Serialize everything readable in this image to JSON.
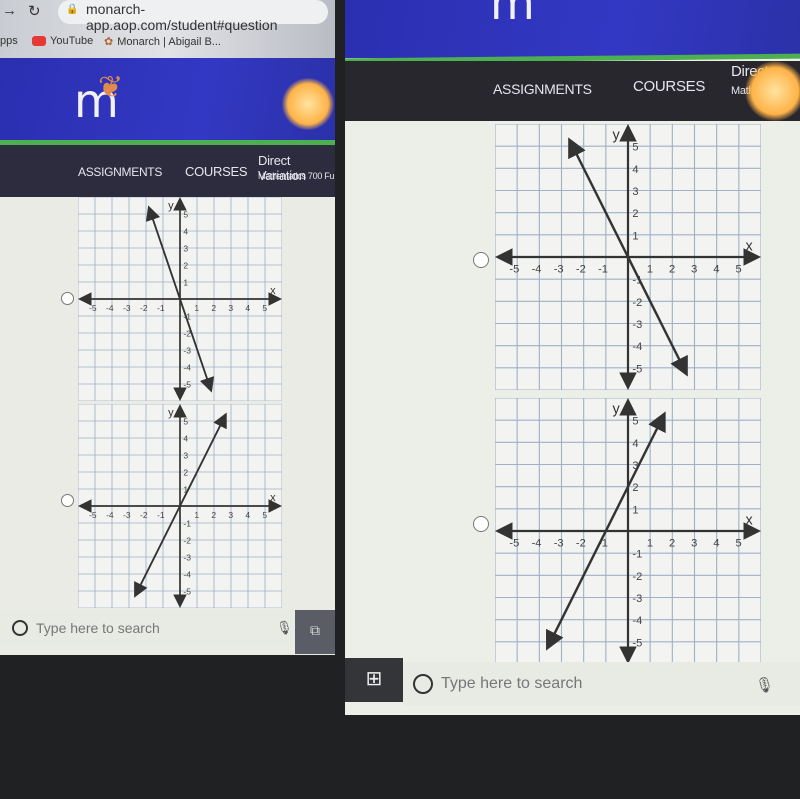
{
  "browser": {
    "url": "monarch-app.aop.com/student#question",
    "bookmarks": [
      "pps",
      "YouTube",
      "Monarch | Abigail B..."
    ]
  },
  "nav": {
    "assignments": "ASSIGNMENTS",
    "courses": "COURSES",
    "lesson_title": "Direct Variation",
    "lesson_subtitle": "Mathematics 700 Fu",
    "lesson_title_partial": "Direct",
    "lesson_subtitle_partial": "Mathe"
  },
  "logo": "m",
  "axis_labels": {
    "x": "x",
    "y": "y"
  },
  "graphs": {
    "left_top": {
      "xlim": [
        -5,
        5
      ],
      "ylim": [
        -5,
        5
      ],
      "line": [
        [
          -1.8,
          5.3
        ],
        [
          1.8,
          -5.3
        ]
      ]
    },
    "left_bottom": {
      "xlim": [
        -5,
        5
      ],
      "ylim": [
        -5,
        5
      ],
      "line": [
        [
          -2.6,
          -5.2
        ],
        [
          2.65,
          5.3
        ]
      ]
    },
    "right_top": {
      "xlim": [
        -5,
        5
      ],
      "ylim": [
        -5,
        5
      ],
      "line": [
        [
          -2.6,
          5.2
        ],
        [
          2.6,
          -5.2
        ]
      ]
    },
    "right_bottom": {
      "xlim": [
        -5,
        5
      ],
      "ylim": [
        -5,
        5
      ],
      "line": [
        [
          -3.6,
          -5.2
        ],
        [
          1.6,
          5.2
        ]
      ]
    }
  },
  "taskbar": {
    "search_placeholder": "Type here to search"
  },
  "colors": {
    "banner": "#3338c4",
    "green_bar": "#4caf50",
    "navbar": "#2d2c3e",
    "grid": "#9fb0c8"
  }
}
